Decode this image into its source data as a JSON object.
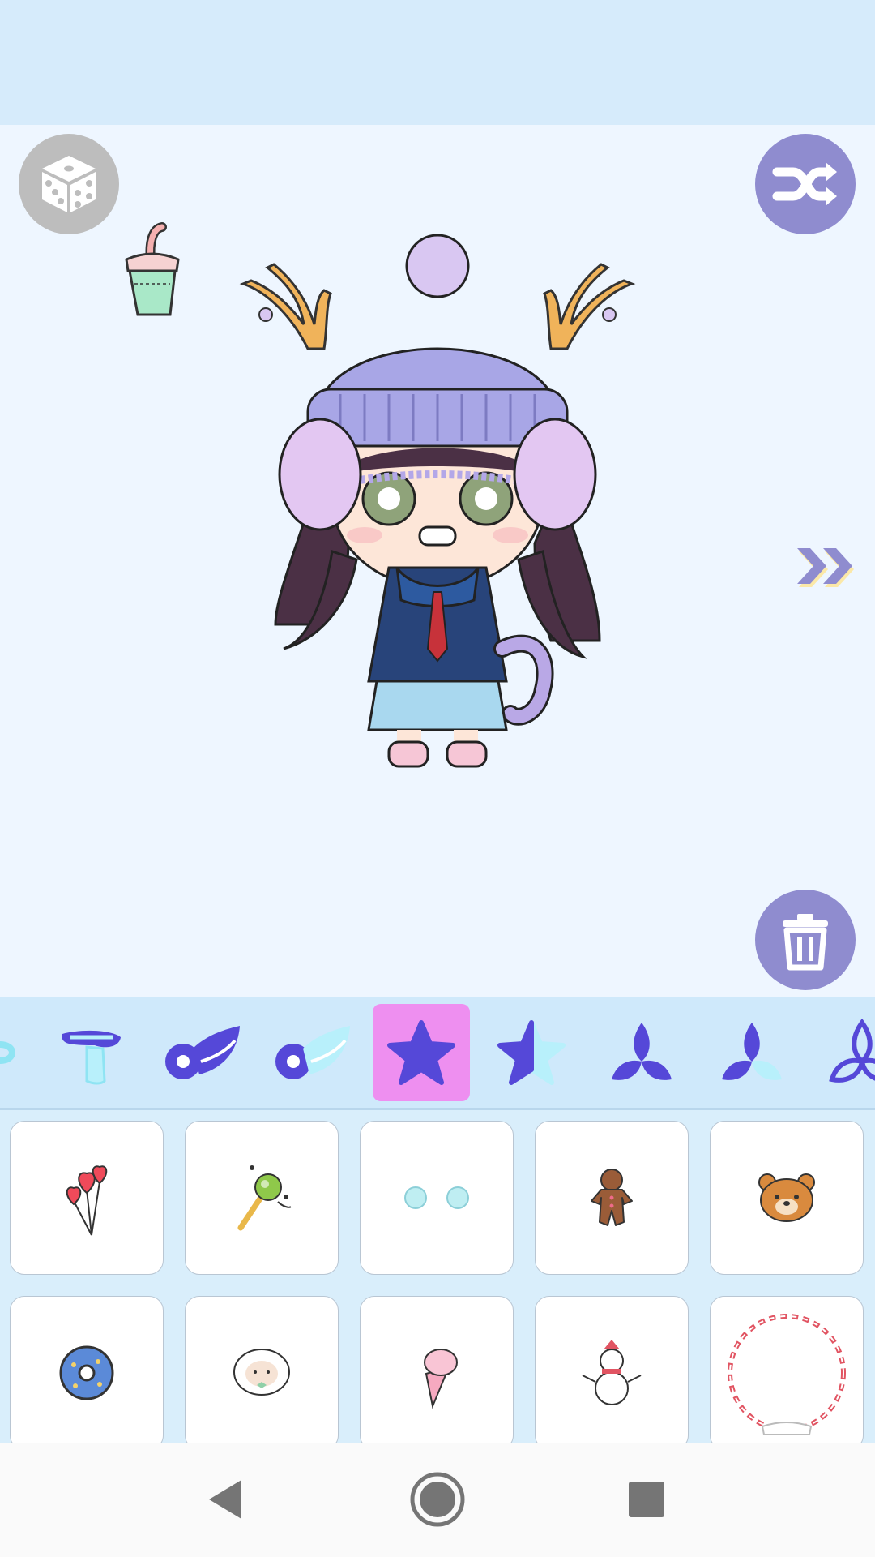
{
  "app": {
    "accent_color": "#8f8ccf",
    "topbar_color": "#d6ebfb",
    "stage_color": "#eef6ff"
  },
  "toolbar": {
    "random_icon": "dice-icon",
    "shuffle_icon": "shuffle-icon",
    "delete_icon": "trash-icon",
    "next_icon": "double-chevron-right-icon"
  },
  "categories": {
    "selected_index": 4,
    "items": [
      {
        "icon": "partial-item-icon"
      },
      {
        "icon": "ribbon-icon"
      },
      {
        "icon": "wing-icon"
      },
      {
        "icon": "wing-light-icon"
      },
      {
        "icon": "star-icon"
      },
      {
        "icon": "half-star-icon"
      },
      {
        "icon": "triquetra-icon"
      },
      {
        "icon": "triquetra-light-icon"
      },
      {
        "icon": "triquetra-outline-icon"
      }
    ]
  },
  "items": [
    {
      "icon": "heart-balloons-icon"
    },
    {
      "icon": "magic-wand-icon"
    },
    {
      "icon": "blue-dots-icon"
    },
    {
      "icon": "gingerbread-man-icon"
    },
    {
      "icon": "bear-face-icon"
    },
    {
      "icon": "donut-icon"
    },
    {
      "icon": "sheep-icon"
    },
    {
      "icon": "ice-cream-icon"
    },
    {
      "icon": "snowman-icon"
    },
    {
      "icon": "candy-wreath-icon"
    }
  ],
  "navigation": {
    "back_icon": "back-triangle-icon",
    "home_icon": "home-circle-icon",
    "recents_icon": "recents-square-icon"
  }
}
